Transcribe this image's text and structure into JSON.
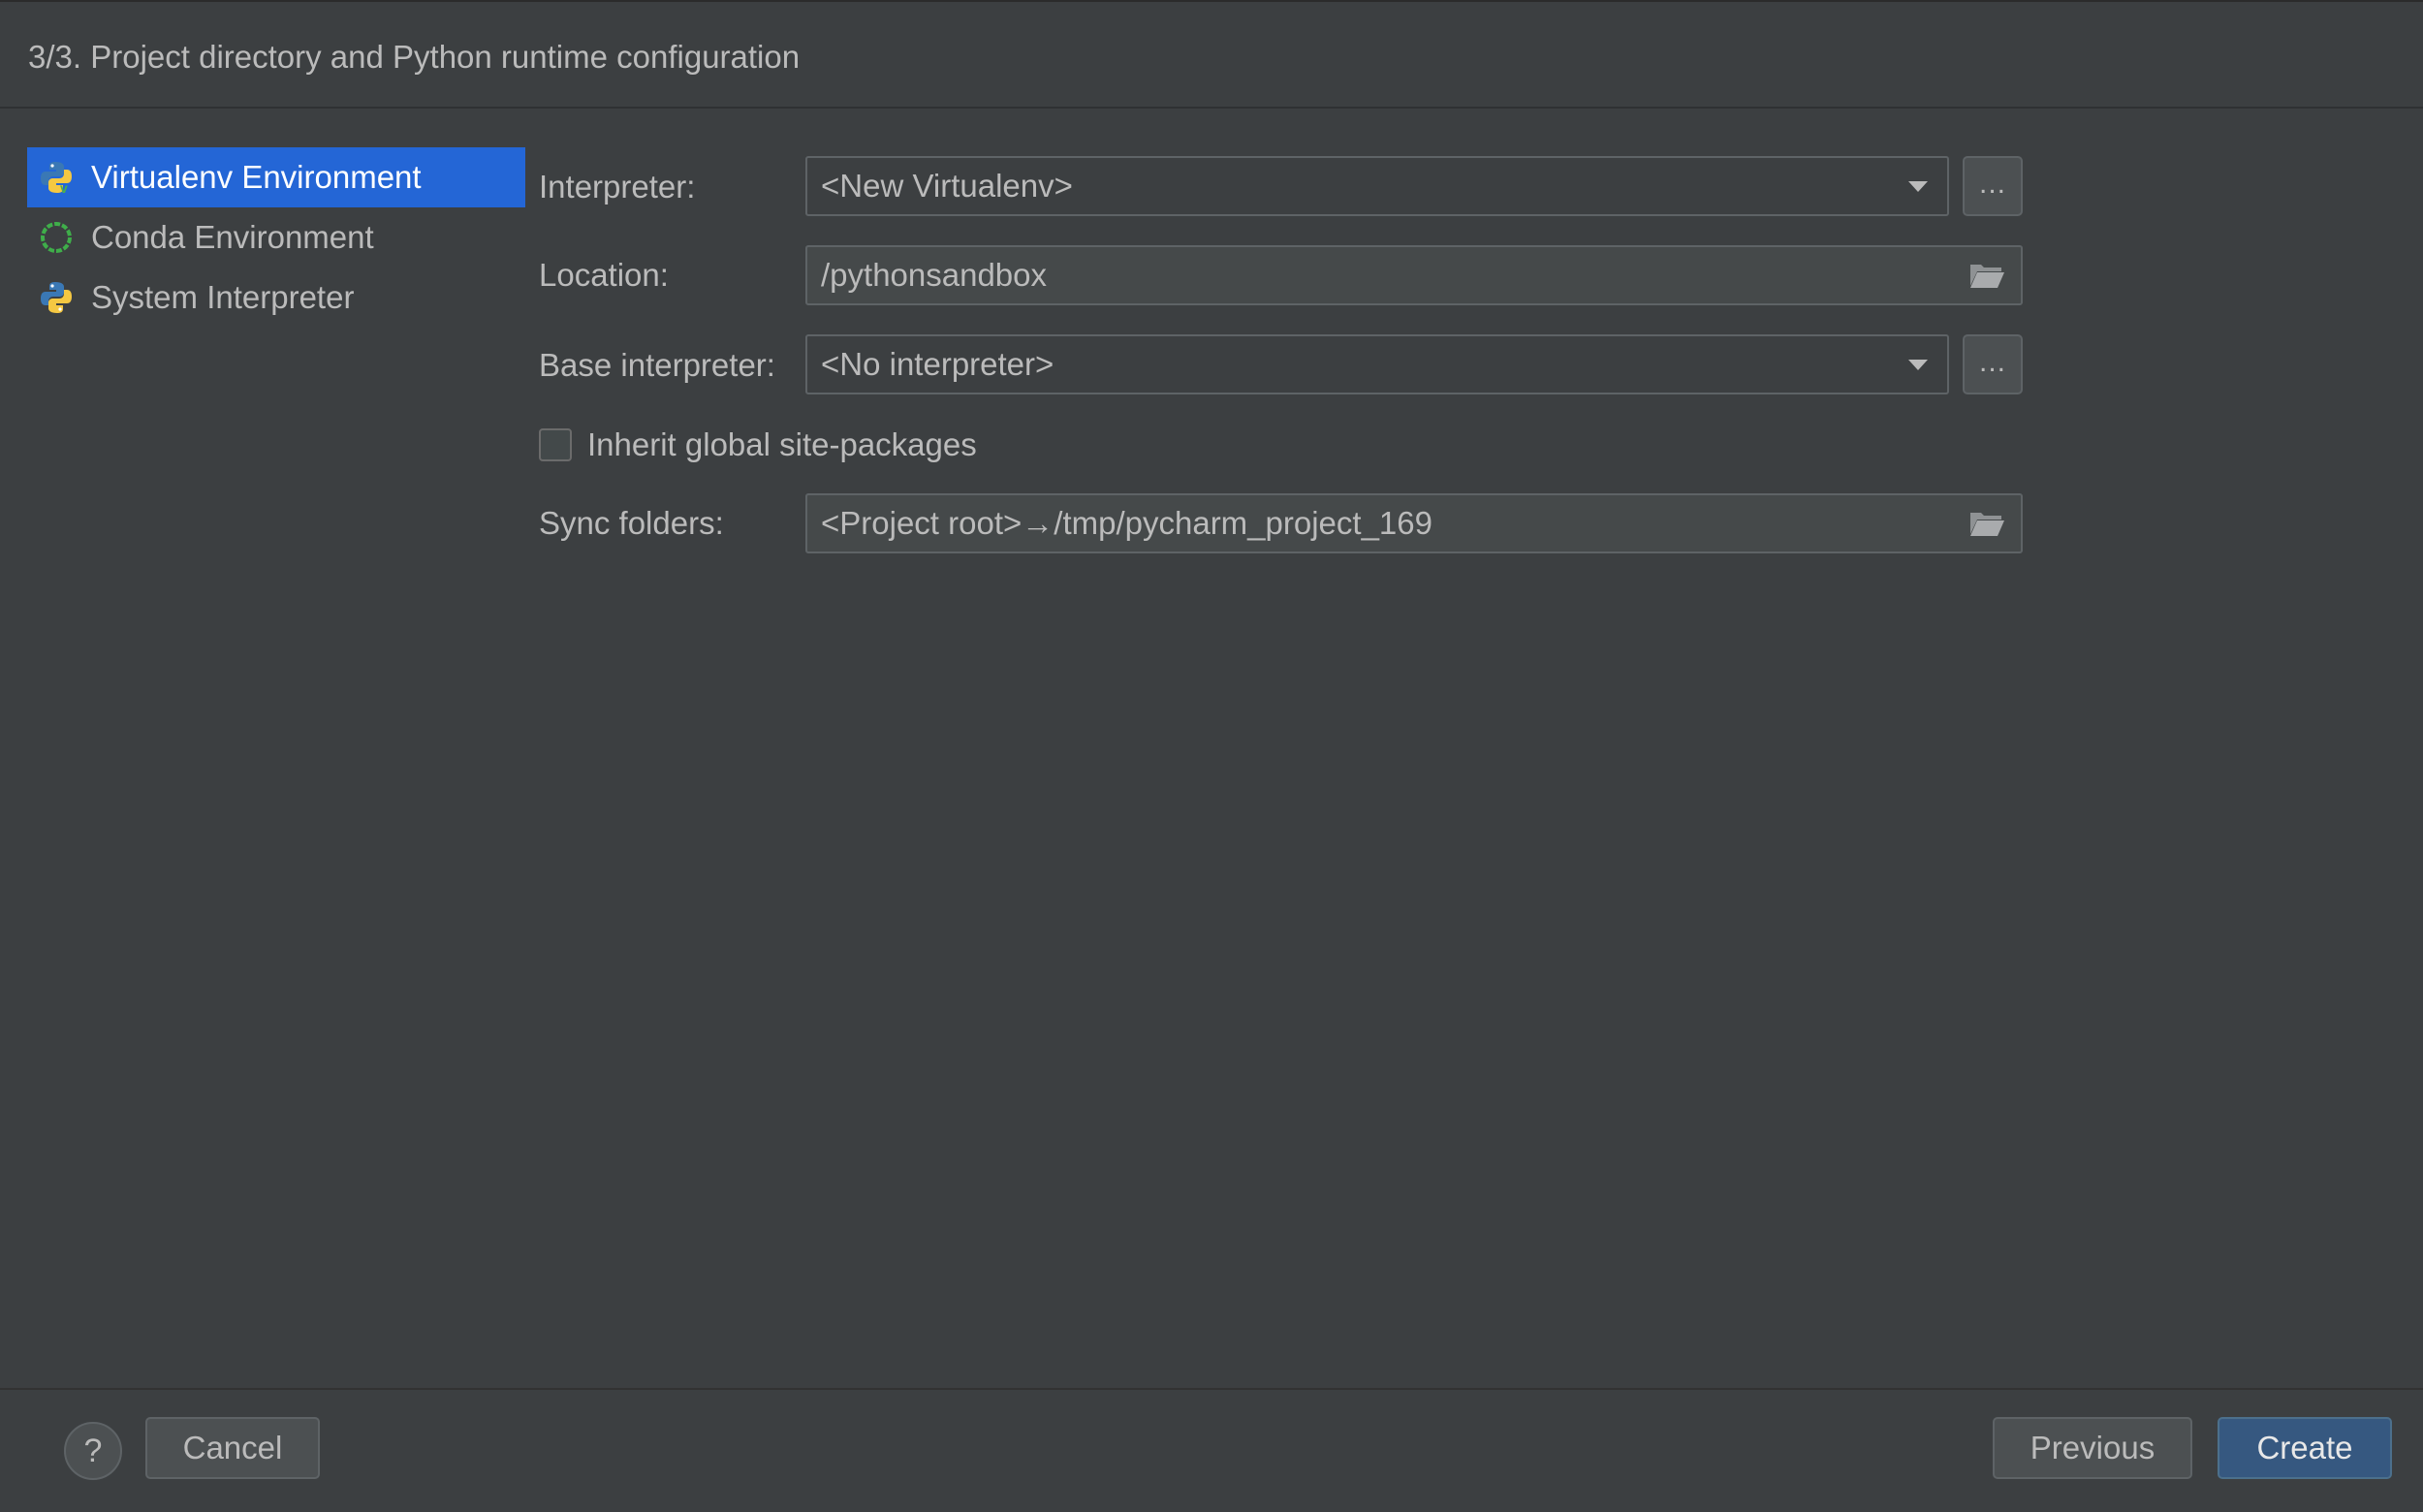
{
  "header": {
    "title": "3/3. Project directory and Python runtime configuration"
  },
  "sidebar": {
    "items": [
      {
        "label": "Virtualenv Environment",
        "icon": "python-virtualenv-icon",
        "selected": true
      },
      {
        "label": "Conda Environment",
        "icon": "conda-icon",
        "selected": false
      },
      {
        "label": "System Interpreter",
        "icon": "python-icon",
        "selected": false
      }
    ]
  },
  "form": {
    "interpreter": {
      "label": "Interpreter:",
      "value": "<New Virtualenv>"
    },
    "location": {
      "label": "Location:",
      "value": "/pythonsandbox"
    },
    "base_interpreter": {
      "label": "Base interpreter:",
      "value": "<No interpreter>"
    },
    "inherit": {
      "label": "Inherit global site-packages",
      "checked": false
    },
    "sync_folders": {
      "label": "Sync folders:",
      "value": "<Project root>→/tmp/pycharm_project_169"
    },
    "browse_label": "..."
  },
  "footer": {
    "help_label": "?",
    "cancel_label": "Cancel",
    "previous_label": "Previous",
    "create_label": "Create"
  },
  "colors": {
    "background": "#3c3f41",
    "selection": "#2466d6",
    "primary_button": "#365880",
    "text": "#bbbbbb"
  }
}
